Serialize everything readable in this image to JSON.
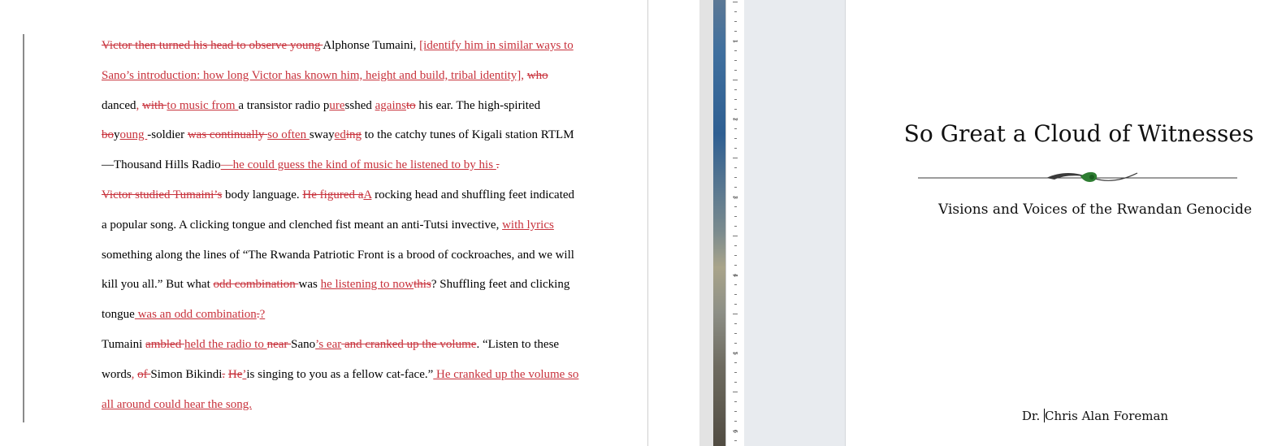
{
  "document": {
    "p1": {
      "d1": "Victor then turned his head to observe young ",
      "t1": "Alphonse Tumaini, ",
      "i1": "[identify him in similar ways to Sano’s introduction: how long Victor has known him, height and build, tribal identity],",
      "s1": " ",
      "d2": "who ",
      "t2": "danced",
      "i2": ",",
      "s2": " ",
      "d3": "with ",
      "i3": "to music from ",
      "t3": "a transistor radio p",
      "i4": "ure",
      "t4": "ss",
      "d4": "",
      "t5": "hed ",
      "i5": "agains",
      "d5": "to",
      "t6": " his ear. The high-spirited ",
      "d6": "bo",
      "t7": "y",
      "i6": "oung ",
      "t8": "-soldier ",
      "d7": "was continually ",
      "i7": "so often ",
      "t9": "sway",
      "i8": "ed",
      "d8": "ing",
      "t10": " to the catchy tunes of Kigali station RTLM—Thousand Hills Radio",
      "i9": "—he could guess the kind of music he listened to by his ",
      "d9": "."
    },
    "p2": {
      "d1": "Victor studied Tumaini’s",
      "t1": " body language. ",
      "d2": "He figured a",
      "i1": "A",
      "t2": " rocking head and shuffling feet indicated a popular song. A clicking tongue and clenched fist meant an anti-Tutsi invective, ",
      "i2": "with lyrics ",
      "t3": "something along the lines of “The Rwanda Patriotic Front is a brood of cockroaches, and we will kill you all.” But what ",
      "d3": "odd combination ",
      "t4": "was ",
      "i3": "he listening to now",
      "d4": "this",
      "t5": "? Shuffling feet and clicking tongue",
      "i4": " was an odd combination",
      "d5": ".",
      "i5": "?"
    },
    "p3": {
      "t1": "Tumaini ",
      "d1": "ambled ",
      "i1": "held the radio to ",
      "d2": "near ",
      "t2": "Sano",
      "i2": "’s ear",
      "d3": " and cranked up the volume",
      "t3": ". “Listen to these words",
      "i3": ",",
      "t4": " ",
      "d4": "of ",
      "t5": "Simon Bikindi",
      "d5": ".",
      "t6": " ",
      "d6": "He",
      "i4": "’",
      "t7": "is singing to you as a fellow cat-face.”",
      "i5": " He cranked up the volume so all around could hear the song."
    }
  },
  "ruler": {
    "labels": [
      "1",
      "2",
      "3",
      "4",
      "5",
      "6"
    ]
  },
  "title_page": {
    "title": "So Great a Cloud of Witnesses",
    "subtitle": "Visions and Voices of the Rwandan Genocide",
    "author_prefix": "Dr. ",
    "author_name": "Chris Alan Foreman"
  },
  "colors": {
    "tracked_change": "#c8323c",
    "ornament_accent": "#2e7d32",
    "pasteboard": "#e8ebef"
  },
  "icons": {
    "ornament": "leaf-flourish-icon",
    "caret": "text-caret"
  }
}
